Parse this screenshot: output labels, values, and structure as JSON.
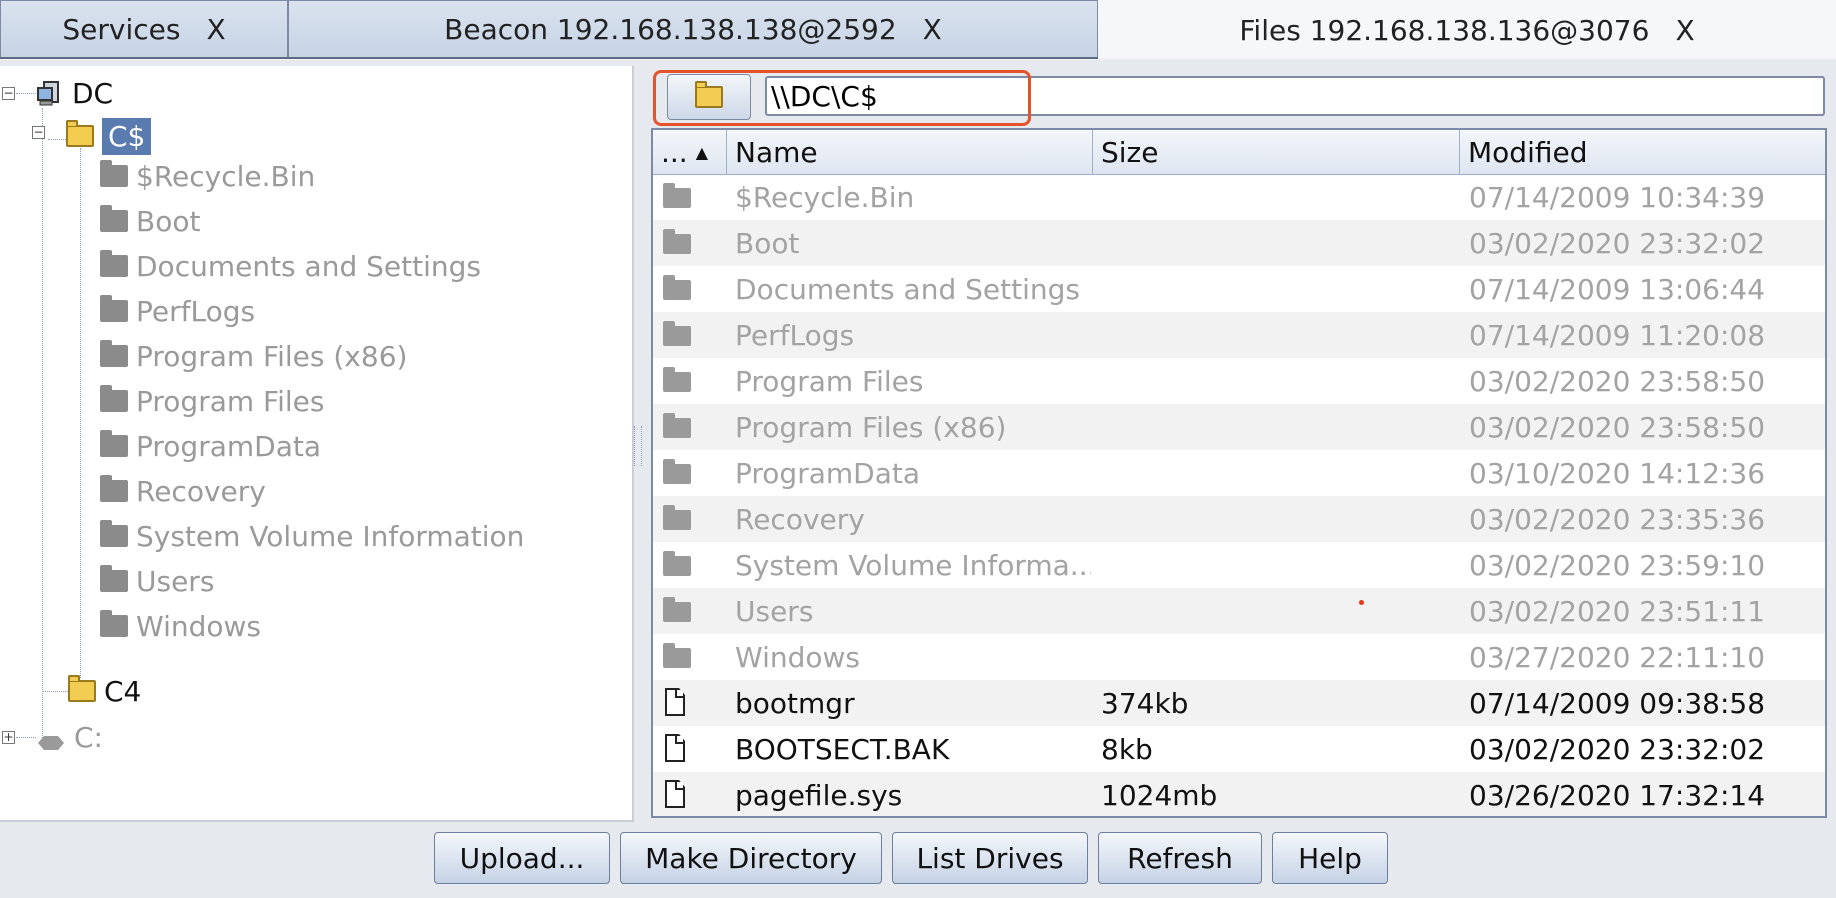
{
  "tabs": [
    {
      "label": "Services",
      "close": "X"
    },
    {
      "label": "Beacon 192.168.138.138@2592",
      "close": "X"
    },
    {
      "label": "Files 192.168.138.136@3076",
      "close": "X"
    }
  ],
  "tree": {
    "root": {
      "label": "DC",
      "icon": "computer-icon"
    },
    "share": {
      "label": "C$",
      "selected": true
    },
    "children": [
      "$Recycle.Bin",
      "Boot",
      "Documents and Settings",
      "PerfLogs",
      "Program Files (x86)",
      "Program Files",
      "ProgramData",
      "Recovery",
      "System Volume Information",
      "Users",
      "Windows"
    ],
    "c4": {
      "label": "C4"
    },
    "drive": {
      "label": "C:",
      "icon": "drive-icon"
    }
  },
  "path": {
    "value": "\\\\DC\\C$"
  },
  "table": {
    "columns": [
      "...",
      "Name",
      "Size",
      "Modified"
    ],
    "sort_indicator": "▲",
    "rows": [
      {
        "type": "folder",
        "name": "$Recycle.Bin",
        "size": "",
        "modified": "07/14/2009 10:34:39"
      },
      {
        "type": "folder",
        "name": "Boot",
        "size": "",
        "modified": "03/02/2020 23:32:02"
      },
      {
        "type": "folder",
        "name": "Documents and Settings",
        "size": "",
        "modified": "07/14/2009 13:06:44"
      },
      {
        "type": "folder",
        "name": "PerfLogs",
        "size": "",
        "modified": "07/14/2009 11:20:08"
      },
      {
        "type": "folder",
        "name": "Program Files",
        "size": "",
        "modified": "03/02/2020 23:58:50"
      },
      {
        "type": "folder",
        "name": "Program Files (x86)",
        "size": "",
        "modified": "03/02/2020 23:58:50"
      },
      {
        "type": "folder",
        "name": "ProgramData",
        "size": "",
        "modified": "03/10/2020 14:12:36"
      },
      {
        "type": "folder",
        "name": "Recovery",
        "size": "",
        "modified": "03/02/2020 23:35:36"
      },
      {
        "type": "folder",
        "name": "System Volume Informa...",
        "size": "",
        "modified": "03/02/2020 23:59:10"
      },
      {
        "type": "folder",
        "name": "Users",
        "size": "",
        "modified": "03/02/2020 23:51:11"
      },
      {
        "type": "folder",
        "name": "Windows",
        "size": "",
        "modified": "03/27/2020 22:11:10"
      },
      {
        "type": "file",
        "name": "bootmgr",
        "size": "374kb",
        "modified": "07/14/2009 09:38:58"
      },
      {
        "type": "file",
        "name": "BOOTSECT.BAK",
        "size": "8kb",
        "modified": "03/02/2020 23:32:02"
      },
      {
        "type": "file",
        "name": "pagefile.sys",
        "size": "1024mb",
        "modified": "03/26/2020 17:32:14"
      }
    ]
  },
  "buttons": {
    "upload": "Upload...",
    "make_directory": "Make Directory",
    "list_drives": "List Drives",
    "refresh": "Refresh",
    "help": "Help"
  },
  "colors": {
    "highlight": "#e4532b",
    "selection": "#5a7bb0"
  }
}
